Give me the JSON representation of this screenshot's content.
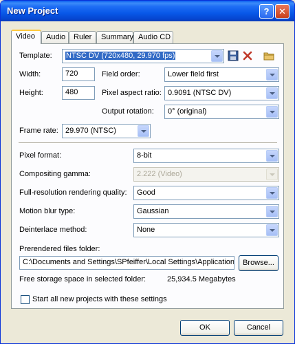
{
  "window": {
    "title": "New Project",
    "help_label": "?",
    "close_label": "✕"
  },
  "tabs": [
    {
      "label": "Video",
      "active": true
    },
    {
      "label": "Audio"
    },
    {
      "label": "Ruler"
    },
    {
      "label": "Summary"
    },
    {
      "label": "Audio CD"
    }
  ],
  "video": {
    "template_label": "Template:",
    "template_value": "NTSC DV (720x480, 29.970 fps)",
    "width_label": "Width:",
    "width_value": "720",
    "height_label": "Height:",
    "height_value": "480",
    "field_order_label": "Field order:",
    "field_order_value": "Lower field first",
    "pixel_aspect_label": "Pixel aspect ratio:",
    "pixel_aspect_value": "0.9091 (NTSC DV)",
    "output_rotation_label": "Output rotation:",
    "output_rotation_value": "0° (original)",
    "frame_rate_label": "Frame rate:",
    "frame_rate_value": "29.970 (NTSC)",
    "pixel_format_label": "Pixel format:",
    "pixel_format_value": "8-bit",
    "compositing_gamma_label": "Compositing gamma:",
    "compositing_gamma_value": "2.222 (Video)",
    "rendering_quality_label": "Full-resolution rendering quality:",
    "rendering_quality_value": "Good",
    "motion_blur_label": "Motion blur type:",
    "motion_blur_value": "Gaussian",
    "deinterlace_label": "Deinterlace method:",
    "deinterlace_value": "None",
    "prerendered_label": "Prerendered files folder:",
    "prerendered_value": "C:\\Documents and Settings\\SPfeiffer\\Local Settings\\Application Data",
    "browse_label": "Browse...",
    "free_space_label": "Free storage space in selected folder:",
    "free_space_value": "25,934.5 Megabytes",
    "start_all_label": "Start all new projects with these settings"
  },
  "buttons": {
    "ok": "OK",
    "cancel": "Cancel"
  },
  "colors": {
    "titlebar": "#0858e8",
    "selection": "#316ac5",
    "delete_icon": "#c0392b"
  }
}
